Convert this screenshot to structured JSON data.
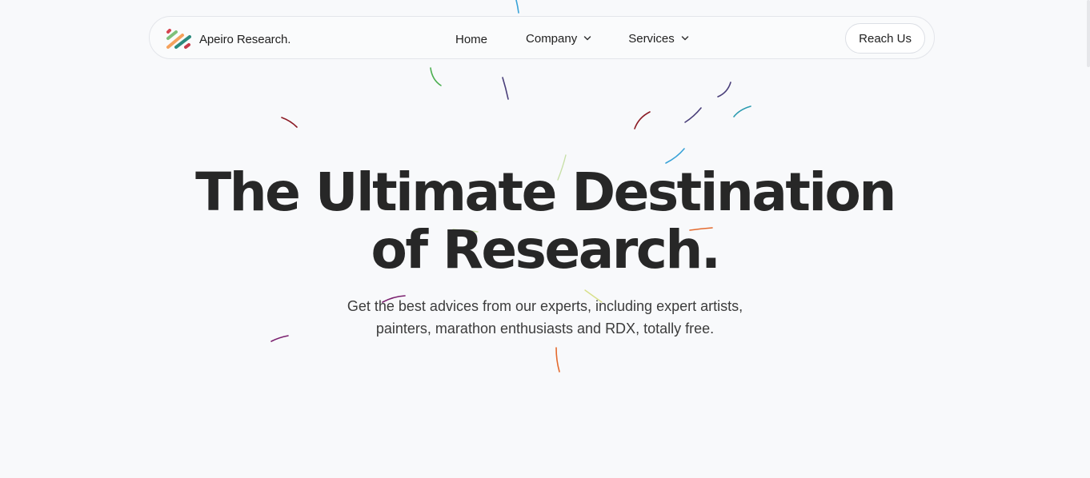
{
  "brand": {
    "name": "Apeiro Research.",
    "logo_icon": "diagonal-stripes-logo-icon",
    "logo_colors": [
      "#d64550",
      "#f5a25d",
      "#7ec07a",
      "#2b8a7e",
      "#c63b4b"
    ]
  },
  "nav": {
    "items": [
      {
        "label": "Home",
        "has_dropdown": false
      },
      {
        "label": "Company",
        "has_dropdown": true,
        "icon": "chevron-down-icon"
      },
      {
        "label": "Services",
        "has_dropdown": true,
        "icon": "chevron-down-icon"
      }
    ],
    "cta_label": "Reach Us"
  },
  "hero": {
    "title_line1": "The Ultimate Destination",
    "title_line2": "of Research.",
    "subtitle": "Get the best advices from our experts, including expert artists, painters, marathon enthusiasts and RDX, totally free."
  },
  "theme": {
    "background": "#f8f9fb",
    "text": "#272727",
    "confetti_colors": [
      "#3aa3d8",
      "#4caf50",
      "#4a3f7a",
      "#8b1a24",
      "#2b9bb0",
      "#e46a2e",
      "#7a1f6e",
      "#d8e08a",
      "#c8e0a8"
    ]
  }
}
